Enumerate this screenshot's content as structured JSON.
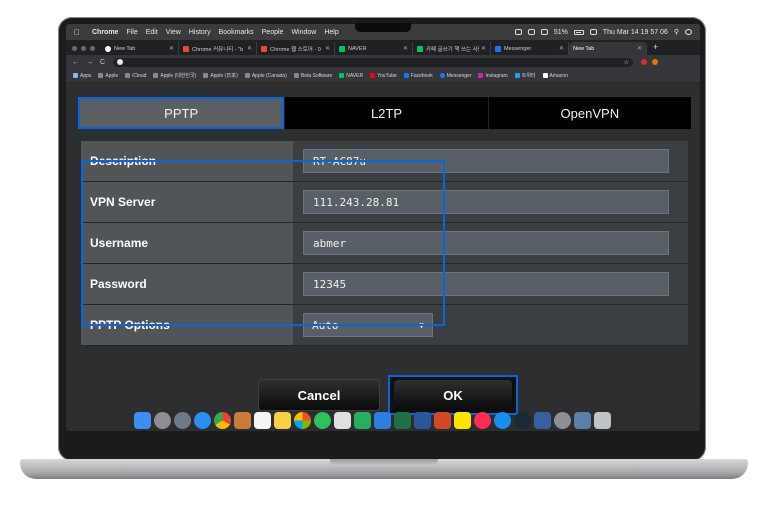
{
  "menubar": {
    "app": "Chrome",
    "items": [
      "File",
      "Edit",
      "View",
      "History",
      "Bookmarks",
      "People",
      "Window",
      "Help"
    ],
    "battery": "51%",
    "clock": "Thu Mar 14  19 57 06"
  },
  "browser_tabs": [
    {
      "title": "New Tab",
      "color": "#ffffff"
    },
    {
      "title": "Chrome 커뮤니티 - \"b",
      "color": "#e34b3c"
    },
    {
      "title": "Chrome 웹 스토어 - 0",
      "color": "#e34b3c"
    },
    {
      "title": "NAVER",
      "color": "#03c75a"
    },
    {
      "title": "카페 글쓰기 책 쓰는 사람",
      "color": "#03c75a"
    },
    {
      "title": "Messenger",
      "color": "#1877f2"
    },
    {
      "title": "New Tab",
      "color": "#888888",
      "active": true
    }
  ],
  "bookmarks": [
    {
      "label": "Apps",
      "color": "#8ab4f8"
    },
    {
      "label": "Apple",
      "color": "#aaaaaa"
    },
    {
      "label": "iCloud",
      "color": "#aaaaaa"
    },
    {
      "label": "Apple (대한민국)",
      "color": "#aaaaaa"
    },
    {
      "label": "Apple (日本)",
      "color": "#aaaaaa"
    },
    {
      "label": "Apple (Canada)",
      "color": "#aaaaaa"
    },
    {
      "label": "Beta Software",
      "color": "#aaaaaa"
    },
    {
      "label": "NAVER",
      "color": "#03c75a"
    },
    {
      "label": "YouTube",
      "color": "#ff0000"
    },
    {
      "label": "Facebook",
      "color": "#1877f2"
    },
    {
      "label": "Messenger",
      "color": "#1877f2"
    },
    {
      "label": "Instagram",
      "color": "#d6249f"
    },
    {
      "label": "트위터",
      "color": "#1da1f2"
    },
    {
      "label": "Amazon",
      "color": "#ffffff"
    }
  ],
  "vpn_tabs": [
    {
      "label": "PPTP",
      "active": true
    },
    {
      "label": "L2TP",
      "active": false
    },
    {
      "label": "OpenVPN",
      "active": false
    }
  ],
  "form": {
    "description_label": "Description",
    "description_value": "RT-AC87u",
    "server_label": "VPN Server",
    "server_value": "111.243.28.81",
    "username_label": "Username",
    "username_value": "abmer",
    "password_label": "Password",
    "password_value": "12345",
    "options_label": "PPTP Options",
    "options_value": "Auto"
  },
  "buttons": {
    "cancel": "Cancel",
    "ok": "OK"
  },
  "colors": {
    "highlight": "#0a66d8",
    "label_bg": "#4f5559",
    "input_bg": "#596065"
  },
  "dock_icons": [
    "finder-icon",
    "launchpad-icon",
    "rocket-icon",
    "safari-icon",
    "chrome-icon",
    "photo-icon",
    "calendar-icon",
    "notes-icon",
    "photos-icon",
    "messages-icon",
    "script-icon",
    "numbers-icon",
    "keynote-icon",
    "excel-icon",
    "word-icon",
    "powerpoint-icon",
    "kakaotalk-icon",
    "music-icon",
    "appstore-icon",
    "steam-icon",
    "vpn-icon",
    "preferences-icon",
    "screen-icon",
    "trash-icon"
  ]
}
